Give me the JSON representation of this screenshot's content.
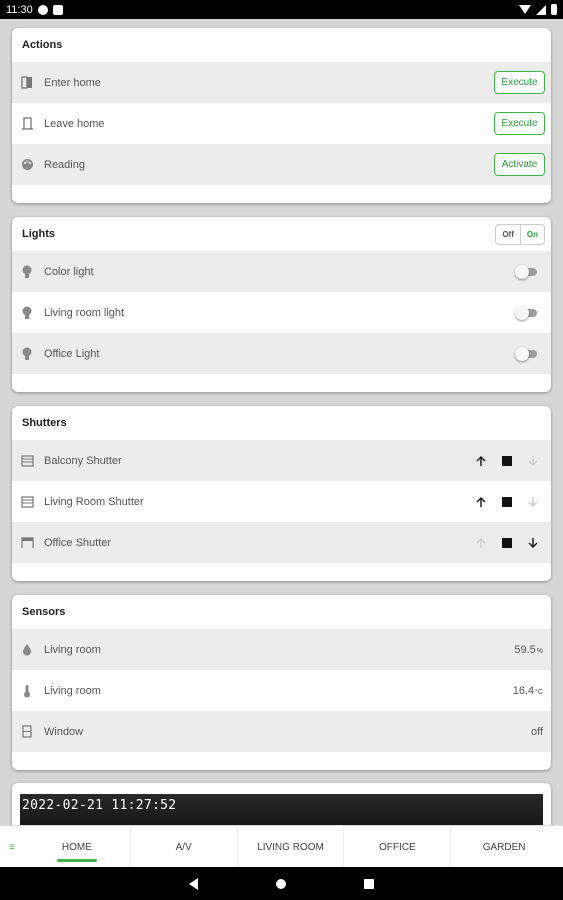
{
  "status_bar": {
    "time": "11:30"
  },
  "actions": {
    "title": "Actions",
    "items": [
      {
        "label": "Enter home",
        "button": "Execute",
        "icon": "door-enter-icon"
      },
      {
        "label": "Leave home",
        "button": "Execute",
        "icon": "door-exit-icon"
      },
      {
        "label": "Reading",
        "button": "Activate",
        "icon": "palette-icon"
      }
    ]
  },
  "lights": {
    "title": "Lights",
    "off_label": "Off",
    "on_label": "On",
    "items": [
      {
        "label": "Color light",
        "on": false
      },
      {
        "label": "Living room light",
        "on": false
      },
      {
        "label": "Office Light",
        "on": false
      }
    ]
  },
  "shutters": {
    "title": "Shutters",
    "items": [
      {
        "label": "Balcony Shutter",
        "state": "closed"
      },
      {
        "label": "Living Room Shutter",
        "state": "closed"
      },
      {
        "label": "Office Shutter",
        "state": "open"
      }
    ]
  },
  "sensors": {
    "title": "Sensors",
    "items": [
      {
        "label": "Living room",
        "value": "59.5",
        "unit": "%",
        "icon": "humidity-icon"
      },
      {
        "label": "Living room",
        "value": "16.4",
        "unit": "°C",
        "icon": "thermometer-icon"
      },
      {
        "label": "Window",
        "value": "off",
        "unit": "",
        "icon": "window-icon"
      }
    ]
  },
  "camera": {
    "timestamp": "2022-02-21  11:27:52"
  },
  "tabs": [
    {
      "label": "HOME",
      "active": true
    },
    {
      "label": "A/V",
      "active": false
    },
    {
      "label": "LIVING ROOM",
      "active": false
    },
    {
      "label": "OFFICE",
      "active": false
    },
    {
      "label": "GARDEN",
      "active": false
    }
  ],
  "colors": {
    "accent": "#41b34a",
    "card_alt_row": "#ececec",
    "background": "#d6d6d6"
  }
}
